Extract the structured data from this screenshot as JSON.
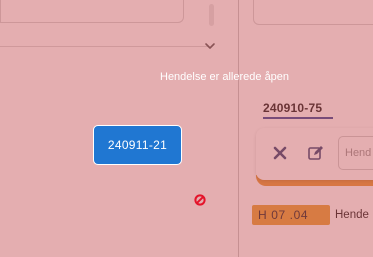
{
  "overlay": {
    "message": "Hendelse er allerede åpen",
    "tint_color": "#c44c50"
  },
  "drag_chip": {
    "label": "240911-21",
    "color": "#2077d2"
  },
  "cursor_icon": "no-drop-icon",
  "case_tab": {
    "label": "240910-75"
  },
  "action_bar": {
    "close_icon": "close-icon",
    "edit_icon": "edit-icon",
    "search_placeholder": "Hend",
    "accent_color": "#e79a3a"
  },
  "event_row": {
    "badge": "H  07 .04",
    "text": "Hende"
  },
  "left_panel": {
    "dropdown_icon": "chevron-down-icon"
  }
}
